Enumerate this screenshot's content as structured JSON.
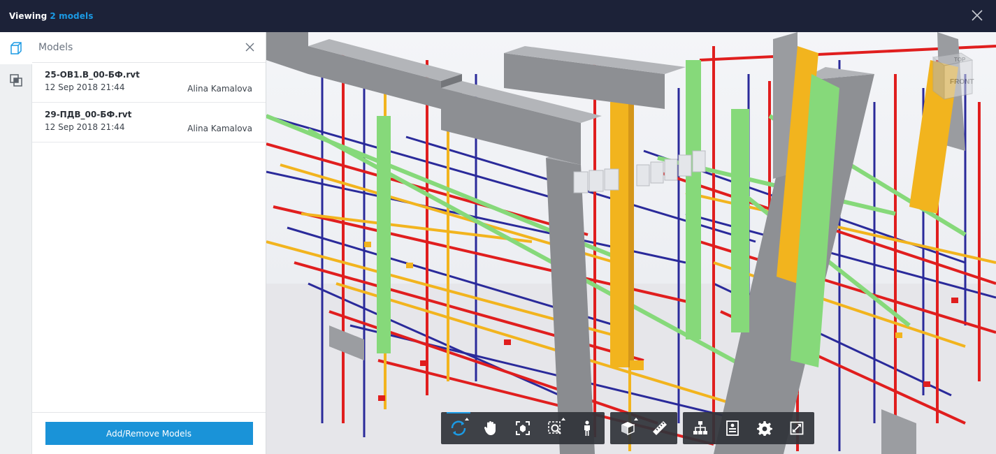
{
  "header": {
    "title_prefix": "Viewing",
    "title_count": "2 models"
  },
  "panel": {
    "title": "Models",
    "items": [
      {
        "name": "25-ОВ1.В_00-БФ.rvt",
        "date": "12 Sep 2018 21:44",
        "author": "Alina Kamalova"
      },
      {
        "name": "29-ПДВ_00-БФ.rvt",
        "date": "12 Sep 2018 21:44",
        "author": "Alina Kamalova"
      }
    ],
    "add_button": "Add/Remove Models"
  },
  "viewcube": {
    "top": "TOP",
    "front": "FRONT"
  },
  "toolbar": {
    "groups": [
      [
        "orbit-icon",
        "pan-icon",
        "fit-to-view-icon",
        "zoom-window-icon",
        "first-person-icon"
      ],
      [
        "section-box-icon",
        "measure-icon"
      ],
      [
        "model-browser-icon",
        "properties-icon",
        "settings-icon",
        "fullscreen-icon"
      ]
    ]
  },
  "colors": {
    "topbar": "#1c2238",
    "accent": "#1b9ae4",
    "button": "#1a93d8",
    "pipe_red": "#e01e1e",
    "pipe_blue": "#2a2a9a",
    "pipe_yellow": "#f2b41e",
    "pipe_green": "#86d97a",
    "duct_gray": "#8a8c90"
  }
}
